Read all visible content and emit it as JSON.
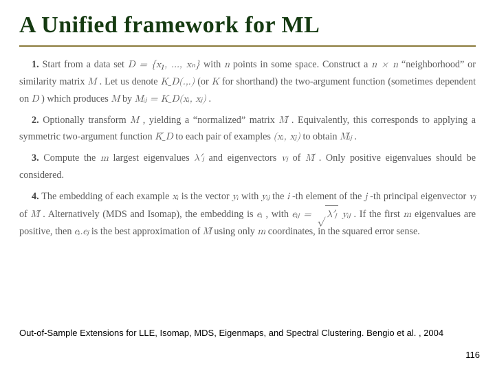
{
  "title": "A Unified framework for ML",
  "steps": {
    "s1_num": "1.",
    "s1_a": "Start from a data set ",
    "s1_D": "D = {x₁, …, xₙ}",
    "s1_b": " with ",
    "s1_n": "n",
    "s1_c": " points in some space. Construct a ",
    "s1_nn": "n × n",
    "s1_d": " “neighborhood” or similarity matrix ",
    "s1_M": "M",
    "s1_e": ". Let us denote ",
    "s1_KD": "K_D(.,.)",
    "s1_f": " (or ",
    "s1_K": "K",
    "s1_g": " for shorthand) the two-argument function (sometimes dependent on ",
    "s1_D2": "D",
    "s1_h": ") which produces ",
    "s1_M2": "M",
    "s1_i": " by ",
    "s1_Mij": "Mᵢⱼ = K_D(xᵢ, xⱼ)",
    "s1_j": ".",
    "s2_num": "2.",
    "s2_a": "Optionally transform ",
    "s2_M": "M",
    "s2_b": ", yielding a “normalized” matrix ",
    "s2_Mt": "M̃",
    "s2_c": ". Equivalently, this corresponds to applying a symmetric two-argument function ",
    "s2_Kt": "K̃_D",
    "s2_d": " to each pair of examples ",
    "s2_xij": "(xᵢ, xⱼ)",
    "s2_e": " to obtain ",
    "s2_Mtij": "M̃ᵢⱼ",
    "s2_f": ".",
    "s3_num": "3.",
    "s3_a": "Compute the ",
    "s3_m": "m",
    "s3_b": " largest eigenvalues ",
    "s3_lam": "λ′ⱼ",
    "s3_c": " and eigenvectors ",
    "s3_vj": "vⱼ",
    "s3_d": " of ",
    "s3_Mt": "M̃",
    "s3_e": ". Only positive eigenvalues should be considered.",
    "s4_num": "4.",
    "s4_a": "The embedding of each example ",
    "s4_xi": "xᵢ",
    "s4_b": " is the vector ",
    "s4_yi": "yᵢ",
    "s4_c": " with ",
    "s4_yij": "yᵢⱼ",
    "s4_d": " the ",
    "s4_i": "i",
    "s4_e": "-th element of the ",
    "s4_j": "j",
    "s4_f": "-th principal eigenvector ",
    "s4_vj": "vⱼ",
    "s4_g": " of ",
    "s4_Mt": "M̃",
    "s4_h": ". Alternatively (MDS and Isomap), the embedding is ",
    "s4_ei": "eᵢ",
    "s4_i2": ", with ",
    "s4_rad_inner": "λ′ⱼ",
    "s4_eij_lhs": "eᵢⱼ = ",
    "s4_eij_tail": " yᵢⱼ",
    "s4_k": ". If the first ",
    "s4_m2": "m",
    "s4_l": " eigenvalues are positive, then ",
    "s4_dot": "eᵢ.eⱼ",
    "s4_m3": " is the best approximation of ",
    "s4_Mt2": "M̃",
    "s4_n": " using only ",
    "s4_m4": "m",
    "s4_o": " coordinates, in the squared error sense."
  },
  "citation": "Out-of-Sample Extensions for LLE, Isomap, MDS, Eigenmaps, and Spectral Clustering. Bengio et al. , 2004",
  "page_number": "116"
}
